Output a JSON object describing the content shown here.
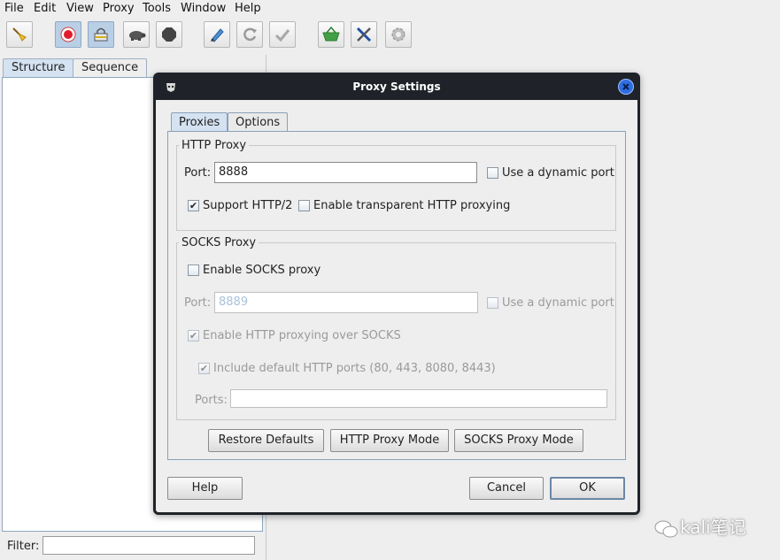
{
  "menu": [
    "File",
    "Edit",
    "View",
    "Proxy",
    "Tools",
    "Window",
    "Help"
  ],
  "left_tabs": [
    "Structure",
    "Sequence"
  ],
  "filter_label": "Filter:",
  "dialog": {
    "title": "Proxy Settings",
    "tabs": [
      "Proxies",
      "Options"
    ],
    "http_proxy": {
      "legend": "HTTP Proxy",
      "port_label": "Port:",
      "port_value": "8888",
      "dynamic_port_label": "Use a dynamic port",
      "support_http2_label": "Support HTTP/2",
      "transparent_label": "Enable transparent HTTP proxying"
    },
    "socks_proxy": {
      "legend": "SOCKS Proxy",
      "enable_label": "Enable SOCKS proxy",
      "port_label": "Port:",
      "port_value": "8889",
      "dynamic_port_label": "Use a dynamic port",
      "http_over_socks_label": "Enable HTTP proxying over SOCKS",
      "include_default_label": "Include default HTTP ports (80, 443, 8080, 8443)",
      "ports_label": "Ports:"
    },
    "buttons": {
      "restore_defaults": "Restore Defaults",
      "http_proxy_mode": "HTTP Proxy Mode",
      "socks_proxy_mode": "SOCKS Proxy Mode",
      "help": "Help",
      "cancel": "Cancel",
      "ok": "OK"
    },
    "checked": {
      "http_dynamic_port": false,
      "support_http2": true,
      "transparent": false,
      "enable_socks": false,
      "socks_dynamic_port": false,
      "http_over_socks": true,
      "include_default_ports": true
    }
  },
  "watermark": "kali笔记",
  "colors": {
    "titlebar": "#1f2329",
    "selected_tab": "#d4e2f1",
    "close_button": "#2f6de0"
  }
}
